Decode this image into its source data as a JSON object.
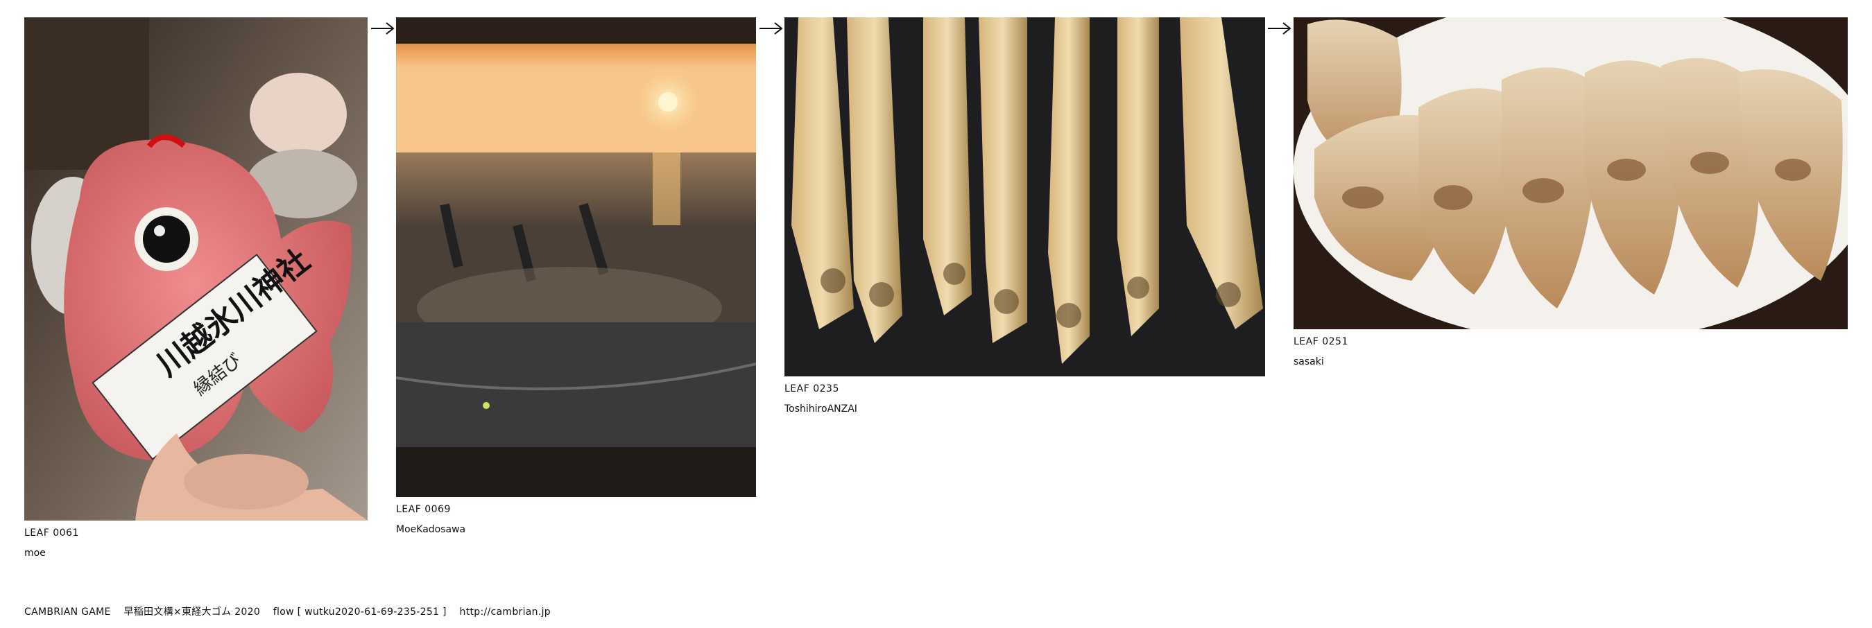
{
  "flow": {
    "items": [
      {
        "leaf": "LEAF 0061",
        "author": "moe",
        "photo_subject": "red sea-bream charm in hand"
      },
      {
        "leaf": "LEAF 0069",
        "author": "MoeKadosawa",
        "photo_subject": "dolphin show at sunset"
      },
      {
        "leaf": "LEAF 0235",
        "author": "ToshihiroANZAI",
        "photo_subject": "grilled fish"
      },
      {
        "leaf": "LEAF 0251",
        "author": "sasaki",
        "photo_subject": "pan-fried gyoza"
      }
    ],
    "arrow_glyph": "→"
  },
  "charm": {
    "line1": "川越氷川神社",
    "line2": "縁結び"
  },
  "footer": {
    "title": "CAMBRIAN GAME",
    "event": "早稲田文構×東経大ゴム 2020",
    "flow": "flow [ wutku2020-61-69-235-251 ]",
    "url": "http://cambrian.jp"
  },
  "colors": {
    "text": "#111111",
    "background": "#ffffff"
  }
}
